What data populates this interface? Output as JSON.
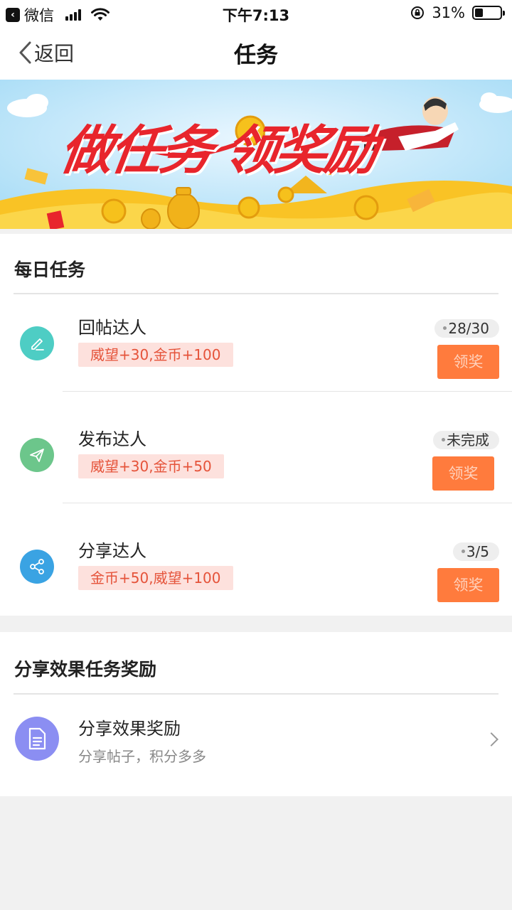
{
  "status_bar": {
    "app_name": "微信",
    "time": "下午7:13",
    "battery": "31%",
    "battery_level": 0.31
  },
  "nav": {
    "back_label": "返回",
    "title": "任务"
  },
  "banner": {
    "title": "做任务 领奖励"
  },
  "daily": {
    "title": "每日任务",
    "tasks": [
      {
        "name": "回帖达人",
        "reward": "威望+30,金币+100",
        "progress": "28/30",
        "button": "领奖",
        "icon": "pencil-icon",
        "color": "#4ecdc4"
      },
      {
        "name": "发布达人",
        "reward": "威望+30,金币+50",
        "progress": "未完成",
        "button": "领奖",
        "icon": "paper-plane-icon",
        "color": "#6cc68b"
      },
      {
        "name": "分享达人",
        "reward": "金币+50,威望+100",
        "progress": "3/5",
        "button": "领奖",
        "icon": "share-icon",
        "color": "#3aa3e3"
      }
    ]
  },
  "share_section": {
    "title": "分享效果任务奖励",
    "item": {
      "name": "分享效果奖励",
      "desc": "分享帖子，积分多多",
      "icon": "document-icon",
      "color": "#8b8ef2"
    }
  },
  "colors": {
    "accent": "#ff7b3d",
    "reward_bg": "#fde1dd",
    "reward_text": "#e5533a"
  }
}
